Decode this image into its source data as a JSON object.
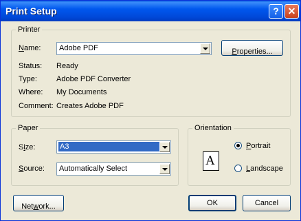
{
  "window": {
    "title": "Print Setup"
  },
  "titlebar": {
    "help_glyph": "?",
    "close_glyph": "✕"
  },
  "printer": {
    "legend": "Printer",
    "name_label": "Name:",
    "name_value": "Adobe PDF",
    "properties_label": "Properties...",
    "status_label": "Status:",
    "status_value": "Ready",
    "type_label": "Type:",
    "type_value": "Adobe PDF Converter",
    "where_label": "Where:",
    "where_value": "My Documents",
    "comment_label": "Comment:",
    "comment_value": "Creates Adobe PDF"
  },
  "paper": {
    "legend": "Paper",
    "size_label": "Size:",
    "size_value": "A3",
    "source_label": "Source:",
    "source_value": "Automatically Select"
  },
  "orientation": {
    "legend": "Orientation",
    "icon_letter": "A",
    "portrait_label": "Portrait",
    "landscape_label": "Landscape",
    "selected": "Portrait"
  },
  "buttons": {
    "network_label": "Network...",
    "ok_label": "OK",
    "cancel_label": "Cancel"
  }
}
